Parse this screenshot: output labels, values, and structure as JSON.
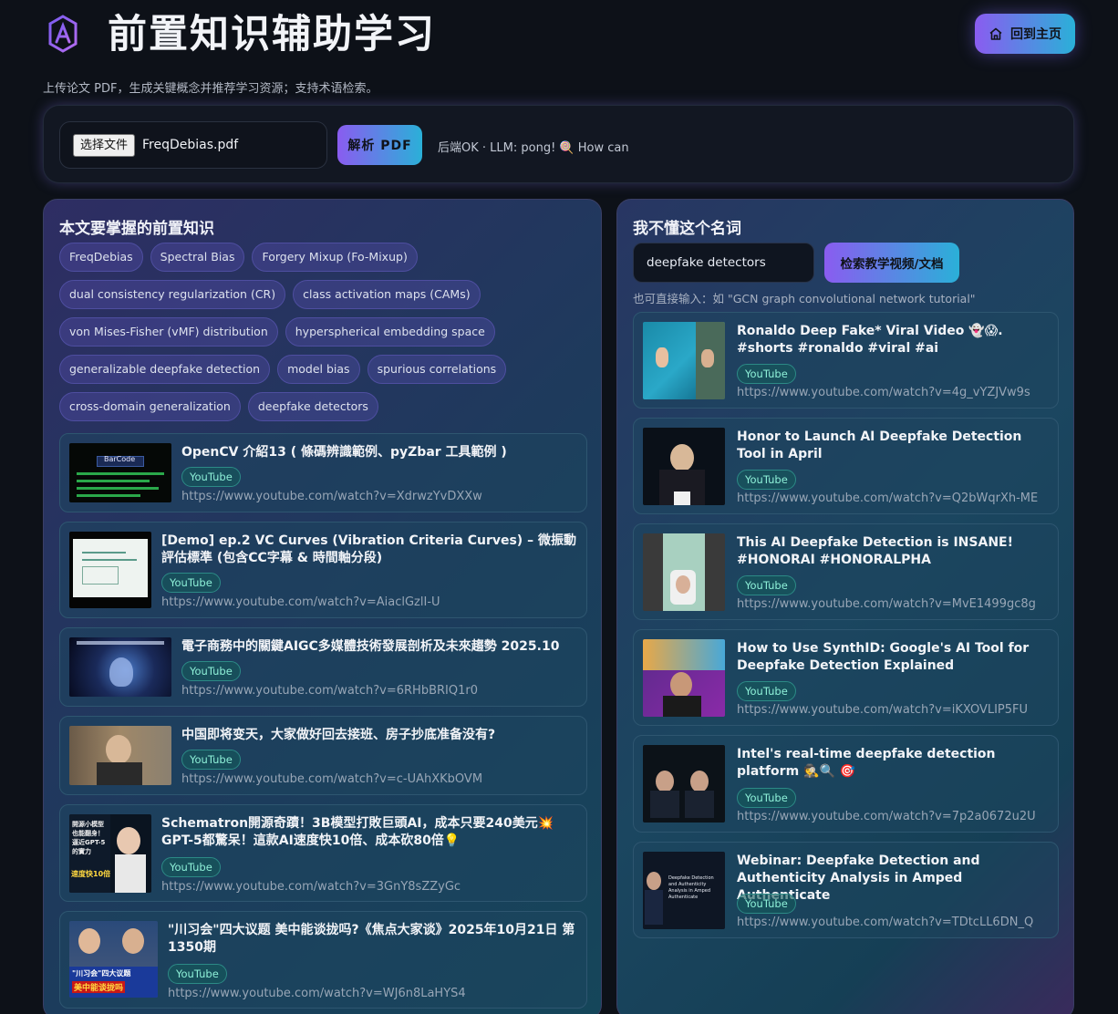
{
  "header": {
    "title": "前置知识辅助学习",
    "home_label": "回到主页",
    "subtitle": "上传论文 PDF，生成关键概念并推荐学习资源；支持术语检索。"
  },
  "upload": {
    "file_button": "选择文件",
    "file_name": "FreqDebias.pdf",
    "parse_button": "解析 PDF",
    "status": "后端OK · LLM: pong! 🍭 How can"
  },
  "left_panel": {
    "title": "本文要掌握的前置知识",
    "chips": [
      "FreqDebias",
      "Spectral Bias",
      "Forgery Mixup (Fo-Mixup)",
      "dual consistency regularization (CR)",
      "class activation maps (CAMs)",
      "von Mises-Fisher (vMF) distribution",
      "hyperspherical embedding space",
      "generalizable deepfake detection",
      "model bias",
      "spurious correlations",
      "cross-domain generalization",
      "deepfake detectors"
    ],
    "results": [
      {
        "title": "OpenCV 介紹13 ( 條碼辨識範例、pyZbar 工具範例 )",
        "tag": "YouTube",
        "url": "https://www.youtube.com/watch?v=XdrwzYvDXXw"
      },
      {
        "title": "[Demo] ep.2 VC Curves (Vibration Criteria Curves) – 微振動評估標準 (包含CC字幕 & 時間軸分段)",
        "tag": "YouTube",
        "url": "https://www.youtube.com/watch?v=AiaclGzlI-U"
      },
      {
        "title": "電子商務中的關鍵AIGC多媒體技術發展剖析及未來趨勢 2025.10",
        "tag": "YouTube",
        "url": "https://www.youtube.com/watch?v=6RHbBRIQ1r0"
      },
      {
        "title": "中国即将变天，大家做好回去接班、房子抄底准备没有?",
        "tag": "YouTube",
        "url": "https://www.youtube.com/watch?v=c-UAhXKbOVM"
      },
      {
        "title": "Schematron開源奇蹟！3B模型打敗巨頭AI，成本只要240美元💥GPT-5都驚呆！這款AI速度快10倍、成本砍80倍💡",
        "tag": "YouTube",
        "url": "https://www.youtube.com/watch?v=3GnY8sZZyGc"
      },
      {
        "title": "\"川习会\"四大议题 美中能谈拢吗?《焦点大家谈》2025年10月21日 第1350期",
        "tag": "YouTube",
        "url": "https://www.youtube.com/watch?v=WJ6n8LaHYS4"
      }
    ],
    "thumb_texts": {
      "t0": "BarCode",
      "t4": "開源小模型也能翻身！逼近GPT-5的實力",
      "t4b": "速度快10倍",
      "t5": "\"川习会\"四大议题",
      "t5b": "美中能谈拢吗"
    }
  },
  "right_panel": {
    "title": "我不懂这个名词",
    "search_value": "deepfake detectors",
    "search_button": "检索教学视频/文档",
    "hint": "也可直接输入：如 \"GCN graph convolutional network tutorial\"",
    "results": [
      {
        "title": "Ronaldo Deep Fake* Viral Video 👻😱. #shorts #ronaldo #viral #ai",
        "tag": "YouTube",
        "url": "https://www.youtube.com/watch?v=4g_vYZJVw9s"
      },
      {
        "title": "Honor to Launch AI Deepfake Detection Tool in April",
        "tag": "YouTube",
        "url": "https://www.youtube.com/watch?v=Q2bWqrXh-ME"
      },
      {
        "title": "This AI Deepfake Detection is INSANE! #HONORAI #HONORALPHA",
        "tag": "YouTube",
        "url": "https://www.youtube.com/watch?v=MvE1499gc8g"
      },
      {
        "title": "How to Use SynthID: Google's AI Tool for Deepfake Detection Explained",
        "tag": "YouTube",
        "url": "https://www.youtube.com/watch?v=iKXOVLIP5FU"
      },
      {
        "title": "Intel's real-time deepfake detection platform 🕵️🔍 🎯",
        "tag": "YouTube",
        "url": "https://www.youtube.com/watch?v=7p2a0672u2U"
      },
      {
        "title": "Webinar: Deepfake Detection and Authenticity Analysis in Amped Authenticate",
        "tag": "YouTube",
        "url": "https://www.youtube.com/watch?v=TDtcLL6DN_Q"
      }
    ],
    "thumb_texts": {
      "r5": "Deepfake Detection and Authenticity Analysis in Amped Authenticate"
    }
  },
  "icons": {
    "logo": "logo-icon",
    "home": "home-icon"
  },
  "colors": {
    "accent_start": "#8a5cf0",
    "accent_end": "#2ab0d8",
    "tag_text": "#8ef0d8"
  }
}
